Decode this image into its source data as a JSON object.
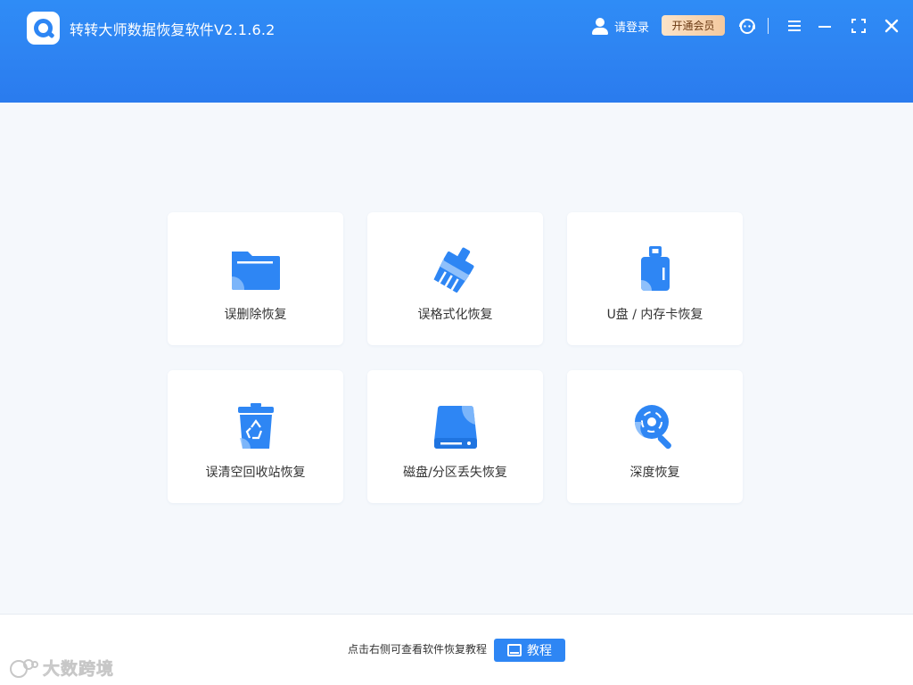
{
  "app": {
    "title": "转转大师数据恢复软件V2.1.6.2"
  },
  "header": {
    "login_label": "请登录",
    "vip_label": "开通会员",
    "icons": [
      "support-icon",
      "menu-icon",
      "minimize-icon",
      "maximize-icon",
      "close-icon"
    ]
  },
  "cards": [
    {
      "label": "误删除恢复",
      "icon": "folder-icon"
    },
    {
      "label": "误格式化恢复",
      "icon": "broom-icon"
    },
    {
      "label": "U盘 / 内存卡恢复",
      "icon": "usb-drive-icon"
    },
    {
      "label": "误清空回收站恢复",
      "icon": "recycle-bin-icon"
    },
    {
      "label": "磁盘/分区丢失恢复",
      "icon": "hard-disk-icon"
    },
    {
      "label": "深度恢复",
      "icon": "deep-scan-icon"
    }
  ],
  "footer": {
    "hint": "点击右侧可查看软件恢复教程",
    "tutorial_label": "教程"
  },
  "watermark": {
    "text": "大数跨境"
  },
  "colors": {
    "primary": "#2e86f4",
    "header_top": "#2f8cf6",
    "vip_gradient": [
      "#fbe3c8",
      "#f4c99f"
    ],
    "background": "#f5f8fc"
  }
}
